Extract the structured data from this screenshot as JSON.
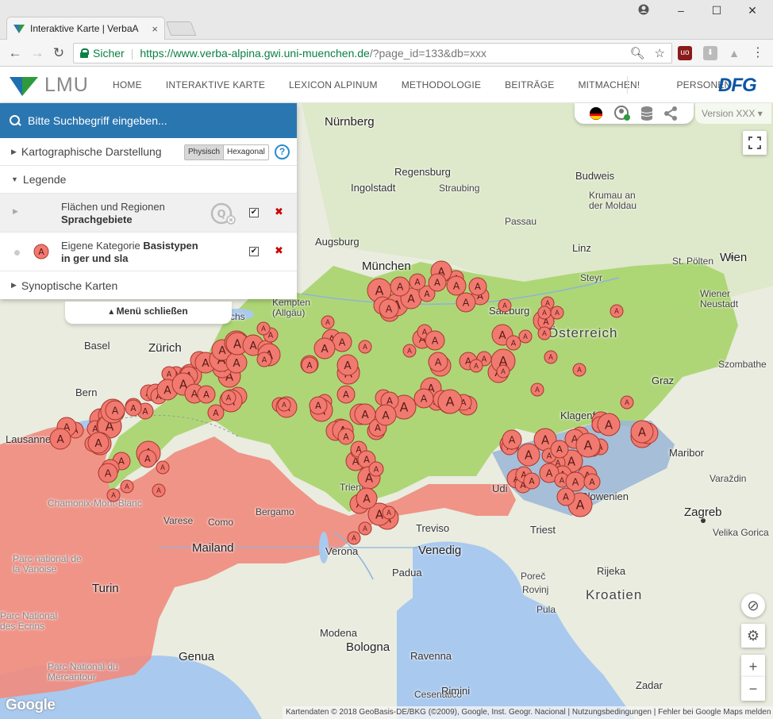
{
  "browser": {
    "tab_title": "Interaktive Karte | VerbaA",
    "tab_close": "×",
    "secure_label": "Sicher",
    "url_main": "https://www.verba-alpina.gwi.uni-muenchen.de",
    "url_rest": "/?page_id=133&db=xxx",
    "window_controls": [
      "user-icon",
      "minimize-icon",
      "maximize-icon",
      "close-icon"
    ]
  },
  "header": {
    "logo_text": "LMU",
    "nav": [
      "HOME",
      "INTERAKTIVE KARTE",
      "LEXICON ALPINUM",
      "METHODOLOGIE",
      "BEITRÄGE",
      "MITMACHEN!",
      "PERSONEN"
    ],
    "dfg_logo": "DFG"
  },
  "panel": {
    "search_placeholder": "Bitte Suchbegriff eingeben...",
    "section_cartographic": "Kartographische Darstellung",
    "toggle_physisch": "Physisch",
    "toggle_hexagonal": "Hexagonal",
    "help": "?",
    "section_legend": "Legende",
    "legend_item1_line1": "Flächen und Regionen",
    "legend_item1_line2": "Sprachgebiete",
    "legend_item2_prefix": "Eigene Kategorie ",
    "legend_item2_bold": "Basistypen",
    "legend_item2_line2": "in ger und sla",
    "marker_letter": "A",
    "section_synoptic": "Synoptische Karten",
    "close_menu": "Menü schließen"
  },
  "toolbar": {
    "version": "Version XXX"
  },
  "map": {
    "labels": [
      {
        "text": "Nürnberg",
        "cls": "big"
      },
      {
        "text": "Regensburg",
        "cls": ""
      },
      {
        "text": "Ingolstadt",
        "cls": ""
      },
      {
        "text": "Straubing",
        "cls": "small"
      },
      {
        "text": "Budweis",
        "cls": ""
      },
      {
        "text": "Krumau an der Moldau",
        "cls": "small"
      },
      {
        "text": "Passau",
        "cls": "small"
      },
      {
        "text": "Augsburg",
        "cls": ""
      },
      {
        "text": "München",
        "cls": "big"
      },
      {
        "text": "Linz",
        "cls": ""
      },
      {
        "text": "Steyr",
        "cls": "small"
      },
      {
        "text": "St. Pölten",
        "cls": "small"
      },
      {
        "text": "Wien",
        "cls": "big"
      },
      {
        "text": "Wiener Neustadt",
        "cls": "small"
      },
      {
        "text": "Salzburg",
        "cls": ""
      },
      {
        "text": "Österreich",
        "cls": "country"
      },
      {
        "text": "Graz",
        "cls": ""
      },
      {
        "text": "Szombathe",
        "cls": "small"
      },
      {
        "text": "Kempten (Allgäu)",
        "cls": "small"
      },
      {
        "text": "Friedrichs",
        "cls": "small"
      },
      {
        "text": "Basel",
        "cls": ""
      },
      {
        "text": "Zürich",
        "cls": "big"
      },
      {
        "text": "Bern",
        "cls": ""
      },
      {
        "text": "Lausanne",
        "cls": ""
      },
      {
        "text": "Klagenfurt",
        "cls": ""
      },
      {
        "text": "Maribor",
        "cls": ""
      },
      {
        "text": "Varaždin",
        "cls": "small"
      },
      {
        "text": "Zagreb",
        "cls": "big"
      },
      {
        "text": "Velika Gorica",
        "cls": "small"
      },
      {
        "text": "Slowenien",
        "cls": ""
      },
      {
        "text": "Udi",
        "cls": ""
      },
      {
        "text": "Triest",
        "cls": ""
      },
      {
        "text": "Treviso",
        "cls": ""
      },
      {
        "text": "Venedig",
        "cls": "big"
      },
      {
        "text": "Padua",
        "cls": ""
      },
      {
        "text": "Verona",
        "cls": ""
      },
      {
        "text": "Trient",
        "cls": "small"
      },
      {
        "text": "Bergamo",
        "cls": "small"
      },
      {
        "text": "Como",
        "cls": "small"
      },
      {
        "text": "Varese",
        "cls": "small"
      },
      {
        "text": "Mailand",
        "cls": "big"
      },
      {
        "text": "Turin",
        "cls": "big"
      },
      {
        "text": "Chamonix-Mont-Blanc",
        "cls": "faint"
      },
      {
        "text": "Parc national de la Vanoise",
        "cls": "faint"
      },
      {
        "text": "Parc National des Ecrins",
        "cls": "faint"
      },
      {
        "text": "Parc National du Mercantour",
        "cls": "faint"
      },
      {
        "text": "Genua",
        "cls": "big"
      },
      {
        "text": "Modena",
        "cls": ""
      },
      {
        "text": "Bologna",
        "cls": "big"
      },
      {
        "text": "Ravenna",
        "cls": ""
      },
      {
        "text": "Cesenatico",
        "cls": "small"
      },
      {
        "text": "Rimini",
        "cls": ""
      },
      {
        "text": "Rijeka",
        "cls": ""
      },
      {
        "text": "Poreč",
        "cls": "small"
      },
      {
        "text": "Rovinj",
        "cls": "small"
      },
      {
        "text": "Pula",
        "cls": "small"
      },
      {
        "text": "Kroatien",
        "cls": "country"
      },
      {
        "text": "Zadar",
        "cls": ""
      }
    ]
  },
  "footer": {
    "google": "Google",
    "attribution": "Kartendaten © 2018 GeoBasis-DE/BKG (©2009), Google, Inst. Geogr. Nacional  |  Nutzungsbedingungen  |  Fehler bei Google Maps melden"
  },
  "colors": {
    "accent": "#2a76b1",
    "marker_fill": "#f07a70",
    "ger_area": "#a8d46e",
    "sla_area": "#9ab6d6",
    "rom_area": "#f08c80"
  }
}
